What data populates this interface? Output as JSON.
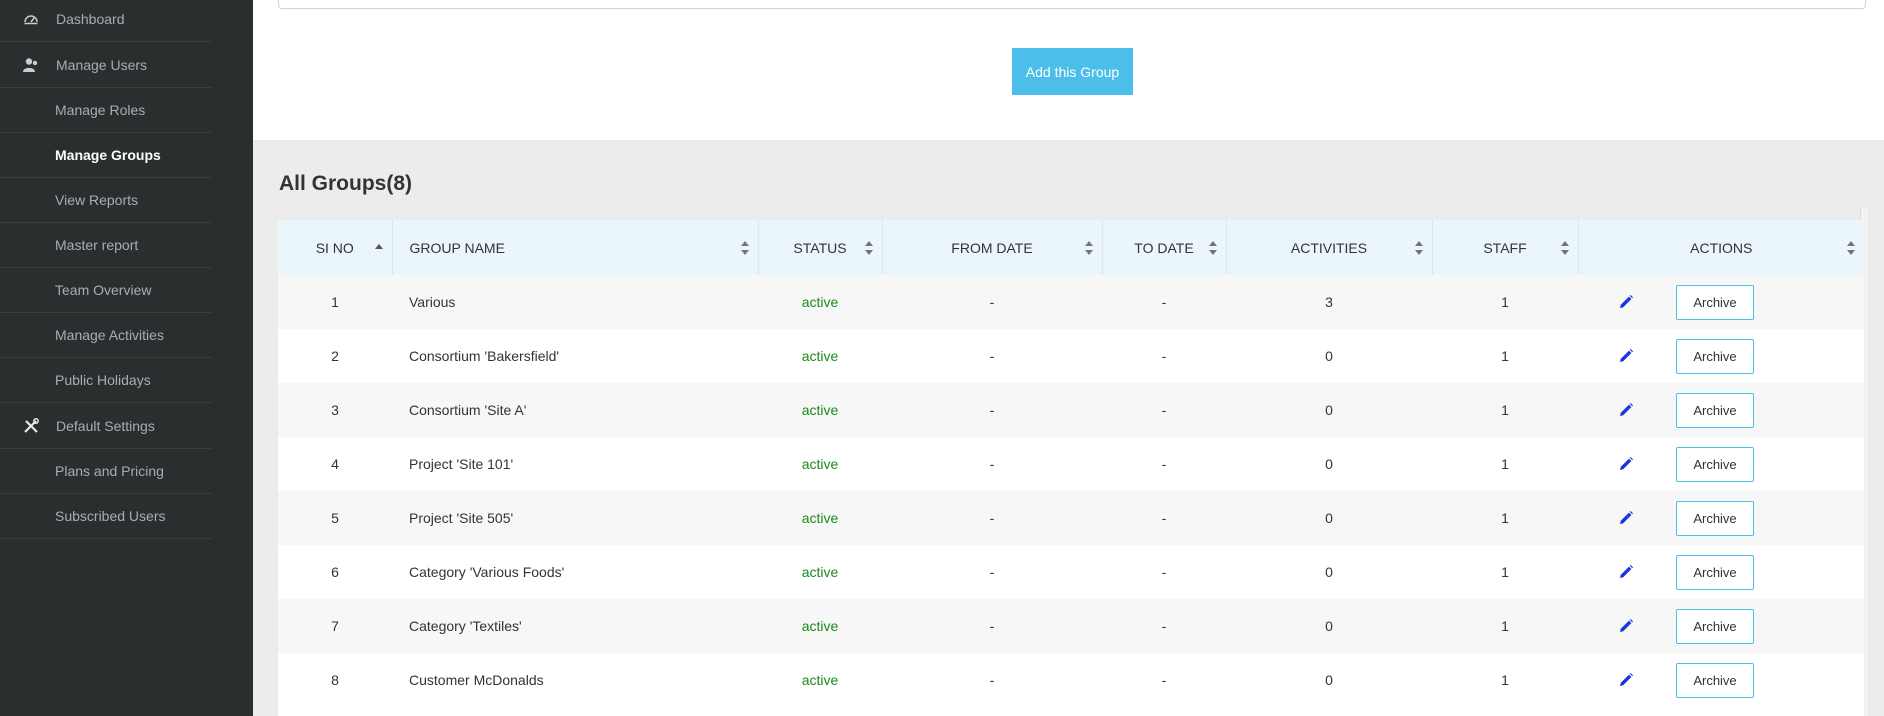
{
  "sidebar": {
    "items": [
      {
        "label": "Dashboard",
        "icon": "dashboard-icon",
        "level": "top"
      },
      {
        "label": "Manage Users",
        "icon": "users-icon",
        "level": "top"
      },
      {
        "label": "Manage Roles",
        "level": "sub"
      },
      {
        "label": "Manage Groups",
        "level": "sub",
        "active": true
      },
      {
        "label": "View Reports",
        "level": "sub"
      },
      {
        "label": "Master report",
        "level": "sub"
      },
      {
        "label": "Team Overview",
        "level": "sub"
      },
      {
        "label": "Manage Activities",
        "level": "sub"
      },
      {
        "label": "Public Holidays",
        "level": "sub"
      },
      {
        "label": "Default Settings",
        "icon": "tools-icon",
        "level": "top"
      },
      {
        "label": "Plans and Pricing",
        "level": "sub"
      },
      {
        "label": "Subscribed Users",
        "level": "sub"
      }
    ]
  },
  "form": {
    "add_button": "Add this Group"
  },
  "groups": {
    "title": "All Groups(8)",
    "columns": [
      "SI NO",
      "GROUP NAME",
      "STATUS",
      "FROM DATE",
      "TO DATE",
      "ACTIVITIES",
      "STAFF",
      "ACTIONS"
    ],
    "archive_label": "Archive",
    "rows": [
      {
        "si": "1",
        "name": "Various",
        "status": "active",
        "from": "-",
        "to": "-",
        "activities": "3",
        "staff": "1"
      },
      {
        "si": "2",
        "name": "Consortium 'Bakersfield'",
        "status": "active",
        "from": "-",
        "to": "-",
        "activities": "0",
        "staff": "1"
      },
      {
        "si": "3",
        "name": "Consortium 'Site A'",
        "status": "active",
        "from": "-",
        "to": "-",
        "activities": "0",
        "staff": "1"
      },
      {
        "si": "4",
        "name": "Project 'Site 101'",
        "status": "active",
        "from": "-",
        "to": "-",
        "activities": "0",
        "staff": "1"
      },
      {
        "si": "5",
        "name": "Project 'Site 505'",
        "status": "active",
        "from": "-",
        "to": "-",
        "activities": "0",
        "staff": "1"
      },
      {
        "si": "6",
        "name": "Category 'Various Foods'",
        "status": "active",
        "from": "-",
        "to": "-",
        "activities": "0",
        "staff": "1"
      },
      {
        "si": "7",
        "name": "Category 'Textiles'",
        "status": "active",
        "from": "-",
        "to": "-",
        "activities": "0",
        "staff": "1"
      },
      {
        "si": "8",
        "name": "Customer McDonalds",
        "status": "active",
        "from": "-",
        "to": "-",
        "activities": "0",
        "staff": "1"
      }
    ]
  },
  "colors": {
    "sidebar_bg": "#2b2e2f",
    "accent": "#4bbfe9",
    "status_active": "#1a8a1a",
    "edit_icon": "#1a35e0"
  }
}
